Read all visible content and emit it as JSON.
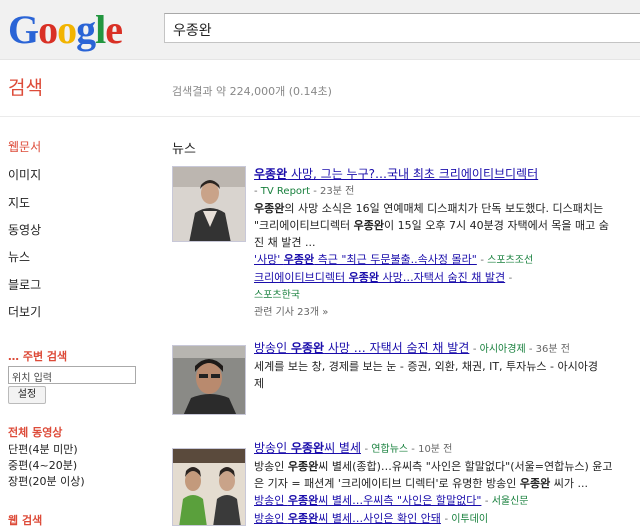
{
  "header": {
    "logo_parts": [
      "G",
      "o",
      "o",
      "g",
      "l",
      "e"
    ],
    "query": "우종완"
  },
  "subheader": {
    "title": "검색",
    "stats": "검색결과 약 224,000개 (0.14초)"
  },
  "sidebar": {
    "nav": [
      "웹문서",
      "이미지",
      "지도",
      "동영상",
      "뉴스",
      "블로그",
      "더보기"
    ],
    "nearby_heading": "… 주변 검색",
    "location_placeholder": "위치 입력",
    "set_button": "설정",
    "video_heading": "전체 동영상",
    "video_filters": [
      "단편(4분 미만)",
      "중편(4~20분)",
      "장편(20분 이상)"
    ],
    "web_heading": "웹 검색"
  },
  "main": {
    "section_title": "뉴스",
    "items": [
      {
        "title_pre": "",
        "title_bold": "우종완",
        "title_post": " 사망, 그는 누구?…국내 최초 크리에이티브디렉터",
        "source": "TV Report",
        "time": "23분 전",
        "snippet_bold": "우종완",
        "snippet_1": "의 사망 소식은 16일 연예매체 디스패치가 단독 보도했다. 디스패치는",
        "snippet_2": "\"크리에이티브디렉터 ",
        "snippet_2_bold": "우종완",
        "snippet_2_post": "이 15일 오후 7시 40분경 자택에서 목을 매고 숨",
        "snippet_3": "진 채 발견 ...",
        "related": [
          {
            "pre": "'사망' ",
            "bold": "우종완",
            "post": " 측근 \"최근 두문불출..속사정 몰라\"",
            "source": "스포츠조선"
          },
          {
            "pre": "크리에이티브디렉터 ",
            "bold": "우종완",
            "post": " 사망…자택서 숨진 채 발견",
            "source": "스포츠한국"
          }
        ],
        "more": "관련 기사 23개 »"
      },
      {
        "title_pre": "방송인 ",
        "title_bold": "우종완",
        "title_post": " 사망 … 자택서 숨진 채 발견",
        "source": "아시아경제",
        "time": "36분 전",
        "snippet_1": "세계를 보는 창, 경제를 보는 눈 - 증권, 외환, 채권, IT, 투자뉴스 - 아시아경",
        "snippet_2": "제"
      },
      {
        "title_pre": "방송인 ",
        "title_bold": "우종완",
        "title_post": "씨 별세",
        "source": "연합뉴스",
        "time": "10분 전",
        "snippet_1_pre": "방송인 ",
        "snippet_1_bold": "우종완",
        "snippet_1_post": "씨 별세(종합)…유씨측 \"사인은 할말없다\"(서울=연합뉴스) 윤고",
        "snippet_2_pre": "은 기자 = 패션계 '크리에이티브 디렉터'로 유명한 방송인 ",
        "snippet_2_bold": "우종완",
        "snippet_2_post": " 씨가 ...",
        "related": [
          {
            "pre": "방송인 ",
            "bold": "우종완",
            "post": "씨 별세…우씨측 \"사인은 할말없다\"",
            "source": "서울신문"
          },
          {
            "pre": "방송인 ",
            "bold": "우종완",
            "post": "씨 별세…사인은 확인 안돼",
            "source": "이투데이"
          }
        ]
      }
    ]
  }
}
